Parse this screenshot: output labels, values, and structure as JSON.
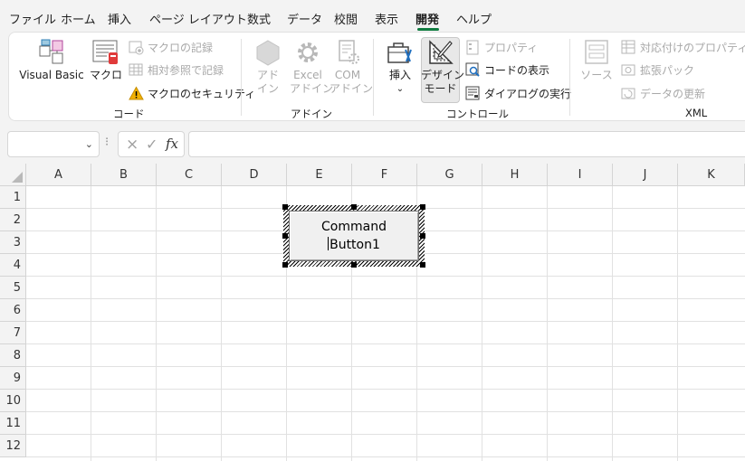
{
  "menu": {
    "tabs": [
      "ファイル",
      "ホーム",
      "挿入",
      "ページ レイアウト",
      "数式",
      "データ",
      "校閲",
      "表示",
      "開発",
      "ヘルプ"
    ],
    "active_tab": "開発"
  },
  "ribbon": {
    "code": {
      "label": "コード",
      "visual_basic": "Visual Basic",
      "macro": "マクロ",
      "record_macro": "マクロの記録",
      "relative_ref": "相対参照で記録",
      "macro_security": "マクロのセキュリティ"
    },
    "addins": {
      "label": "アドイン",
      "addin_1": "アド",
      "addin_2": "イン",
      "excel_addin_1": "Excel",
      "excel_addin_2": "アドイン",
      "com_addin_1": "COM",
      "com_addin_2": "アドイン"
    },
    "controls": {
      "label": "コントロール",
      "insert": "挿入",
      "design_1": "デザイン",
      "design_2": "モード",
      "properties": "プロパティ",
      "view_code": "コードの表示",
      "run_dialog": "ダイアログの実行"
    },
    "xml": {
      "label": "XML",
      "source": "ソース",
      "map_properties": "対応付けのプロパティ",
      "expansion_packs": "拡張パック",
      "refresh_data": "データの更新"
    }
  },
  "formula_bar": {
    "name_box": "",
    "fx": "fx",
    "formula": ""
  },
  "sheet": {
    "columns": [
      "A",
      "B",
      "C",
      "D",
      "E",
      "F",
      "G",
      "H",
      "I",
      "J",
      "K"
    ],
    "rows": [
      "1",
      "2",
      "3",
      "4",
      "5",
      "6",
      "7",
      "8",
      "9",
      "10",
      "11",
      "12"
    ]
  },
  "command_button": {
    "line1": "Command",
    "line2": "Button1"
  }
}
